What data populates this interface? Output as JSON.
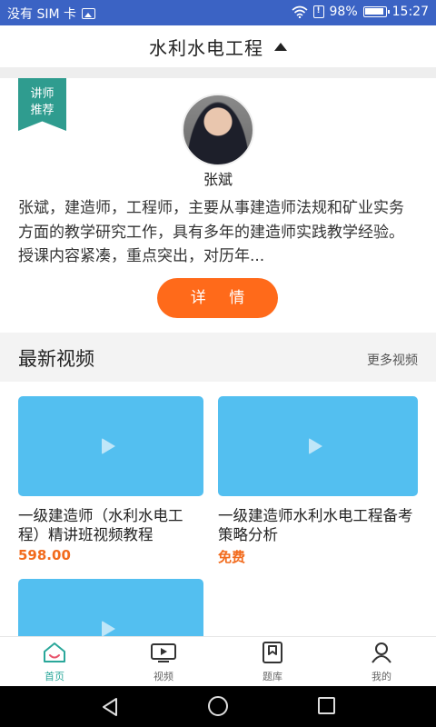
{
  "status_bar": {
    "carrier": "没有 SIM 卡",
    "battery_percent": "98%",
    "time": "15:27"
  },
  "header": {
    "title": "水利水电工程"
  },
  "teacher": {
    "ribbon_line1": "讲师",
    "ribbon_line2": "推荐",
    "name": "张斌",
    "description": "张斌，建造师，工程师，主要从事建造师法规和矿业实务方面的教学研究工作，具有多年的建造师实践教学经验。授课内容紧凑，重点突出，对历年...",
    "detail_button": "详 情"
  },
  "latest_videos": {
    "title": "最新视频",
    "more_link": "更多视频",
    "items": [
      {
        "title": "一级建造师（水利水电工程）精讲班视频教程",
        "price": "598.00"
      },
      {
        "title": "一级建造师水利水电工程备考策略分析",
        "price": "免费"
      },
      {
        "title": "",
        "price": ""
      }
    ]
  },
  "tab_bar": {
    "tabs": [
      {
        "label": "首页",
        "icon": "home-icon",
        "active": true
      },
      {
        "label": "视频",
        "icon": "tv-icon",
        "active": false
      },
      {
        "label": "题库",
        "icon": "bookmark-icon",
        "active": false
      },
      {
        "label": "我的",
        "icon": "user-icon",
        "active": false
      }
    ]
  },
  "colors": {
    "status_bar": "#3b63c4",
    "accent_teal": "#2aa79a",
    "accent_orange": "#ff6a1a",
    "thumbnail_blue": "#53bff0"
  }
}
